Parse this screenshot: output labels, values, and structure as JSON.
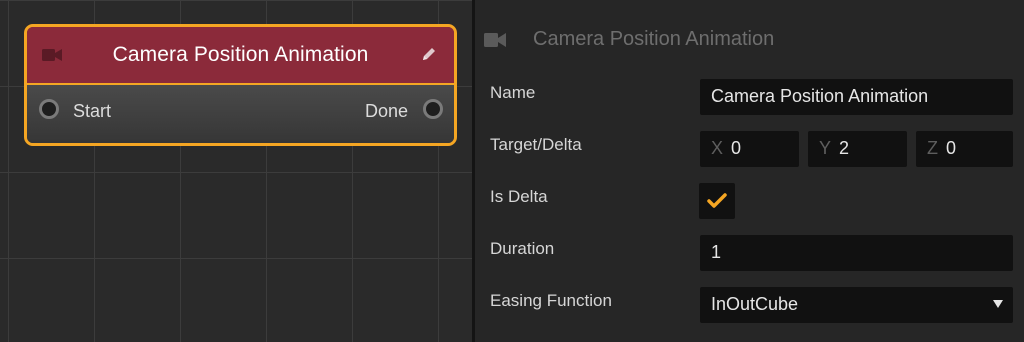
{
  "node": {
    "title": "Camera Position Animation",
    "header_icon": "video-camera-icon",
    "edit_icon": "pencil-icon",
    "input_port_label": "Start",
    "output_port_label": "Done"
  },
  "inspector": {
    "title": "Camera Position Animation",
    "header_icon": "video-camera-icon",
    "fields": {
      "name": {
        "label": "Name",
        "value": "Camera Position Animation"
      },
      "target_delta": {
        "label": "Target/Delta",
        "x_label": "X",
        "x_value": "0",
        "y_label": "Y",
        "y_value": "2",
        "z_label": "Z",
        "z_value": "0"
      },
      "is_delta": {
        "label": "Is Delta",
        "checked": true
      },
      "duration": {
        "label": "Duration",
        "value": "1"
      },
      "easing": {
        "label": "Easing Function",
        "value": "InOutCube"
      }
    }
  },
  "colors": {
    "accent": "#f5a623",
    "node_header": "#8b2a3a",
    "canvas_bg": "#2a2a2a",
    "panel_bg": "#262626",
    "field_bg": "#111111"
  }
}
